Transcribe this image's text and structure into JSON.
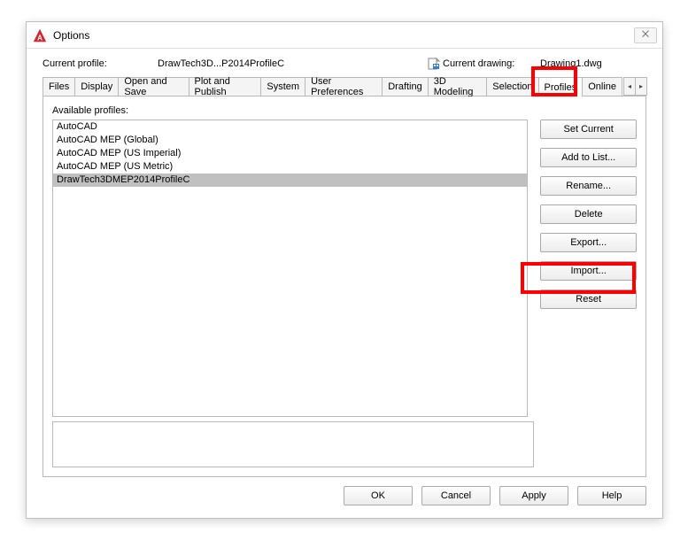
{
  "window": {
    "title": "Options",
    "close_glyph": "⨉"
  },
  "header": {
    "current_profile_label": "Current profile:",
    "current_profile_value": "DrawTech3D...P2014ProfileC",
    "current_drawing_label": "Current drawing:",
    "current_drawing_value": "Drawing1.dwg"
  },
  "tabs": {
    "items": [
      "Files",
      "Display",
      "Open and Save",
      "Plot and Publish",
      "System",
      "User Preferences",
      "Drafting",
      "3D Modeling",
      "Selection",
      "Profiles",
      "Online"
    ],
    "active_index": 9,
    "scroll_left": "◂",
    "scroll_right": "▸"
  },
  "panel": {
    "available_label": "Available profiles:",
    "profiles": [
      {
        "name": "AutoCAD",
        "selected": false
      },
      {
        "name": "AutoCAD MEP (Global)",
        "selected": false
      },
      {
        "name": "AutoCAD MEP (US Imperial)",
        "selected": false
      },
      {
        "name": "AutoCAD MEP (US Metric)",
        "selected": false
      },
      {
        "name": "DrawTech3DMEP2014ProfileC",
        "selected": true
      }
    ],
    "buttons": {
      "set_current": "Set Current",
      "add_to_list": "Add to List...",
      "rename": "Rename...",
      "delete": "Delete",
      "export": "Export...",
      "import": "Import...",
      "reset": "Reset"
    }
  },
  "footer": {
    "ok": "OK",
    "cancel": "Cancel",
    "apply": "Apply",
    "help": "Help"
  }
}
